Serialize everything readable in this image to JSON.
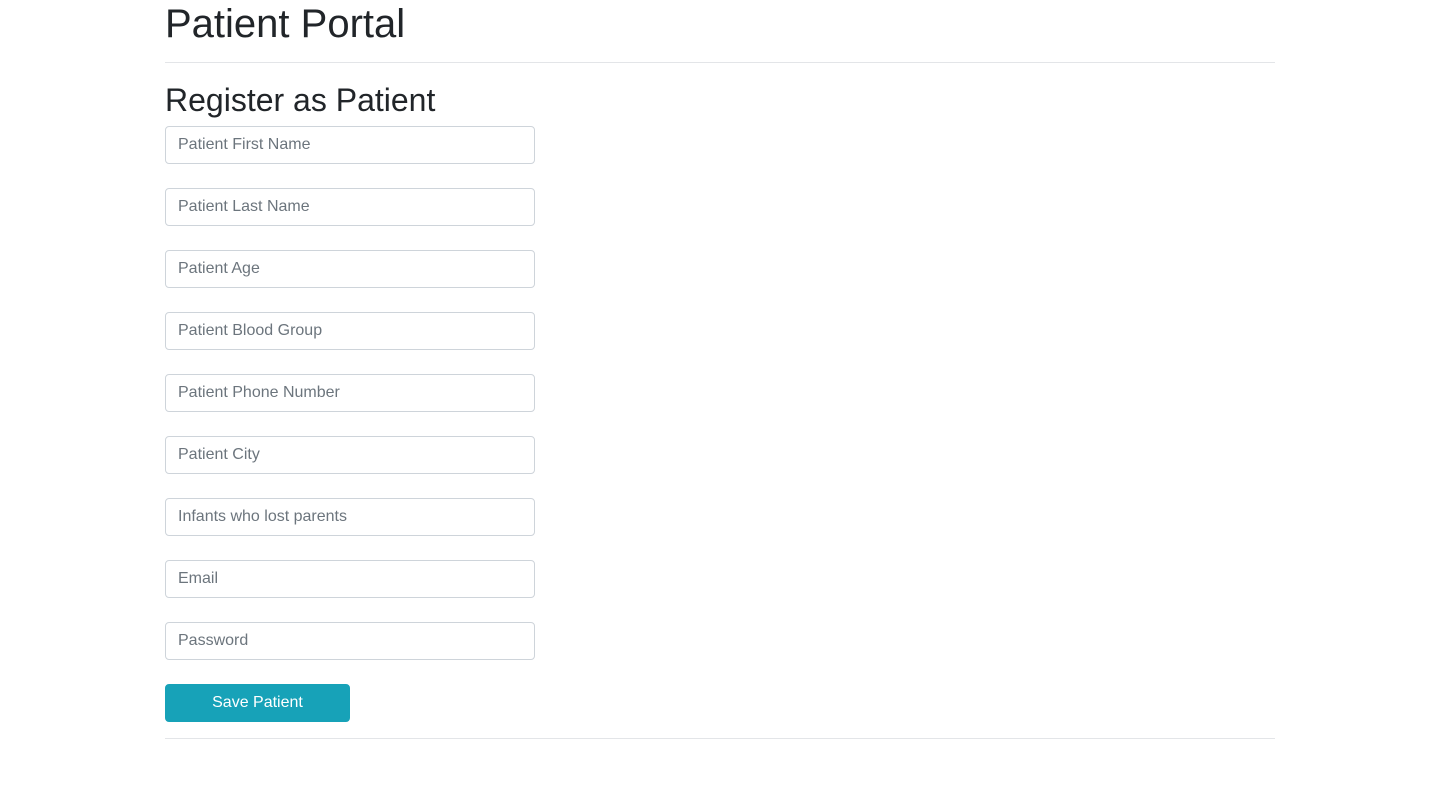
{
  "header": {
    "title": "Patient Portal"
  },
  "registration": {
    "heading": "Register as Patient",
    "fields": {
      "first_name": {
        "placeholder": "Patient First Name",
        "value": ""
      },
      "last_name": {
        "placeholder": "Patient Last Name",
        "value": ""
      },
      "age": {
        "placeholder": "Patient Age",
        "value": ""
      },
      "blood_group": {
        "placeholder": "Patient Blood Group",
        "value": ""
      },
      "phone": {
        "placeholder": "Patient Phone Number",
        "value": ""
      },
      "city": {
        "placeholder": "Patient City",
        "value": ""
      },
      "infants": {
        "placeholder": "Infants who lost parents",
        "value": ""
      },
      "email": {
        "placeholder": "Email",
        "value": ""
      },
      "password": {
        "placeholder": "Password",
        "value": ""
      }
    },
    "save_label": "Save Patient"
  },
  "colors": {
    "accent": "#17a2b8",
    "text": "#212529",
    "placeholder": "#6c757d",
    "border": "#ced4da",
    "divider": "#e3e5e8"
  }
}
